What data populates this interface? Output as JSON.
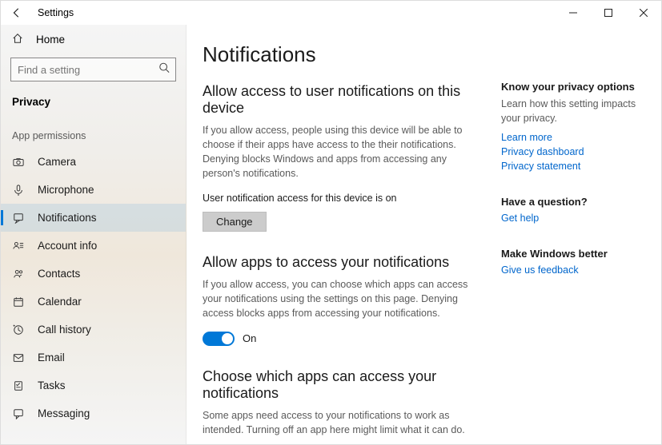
{
  "window": {
    "app_title": "Settings"
  },
  "sidebar": {
    "home_label": "Home",
    "search_placeholder": "Find a setting",
    "section_title": "Privacy",
    "group_label": "App permissions",
    "items": [
      {
        "label": "Camera"
      },
      {
        "label": "Microphone"
      },
      {
        "label": "Notifications"
      },
      {
        "label": "Account info"
      },
      {
        "label": "Contacts"
      },
      {
        "label": "Calendar"
      },
      {
        "label": "Call history"
      },
      {
        "label": "Email"
      },
      {
        "label": "Tasks"
      },
      {
        "label": "Messaging"
      }
    ]
  },
  "main": {
    "page_title": "Notifications",
    "section1": {
      "heading": "Allow access to user notifications on this device",
      "desc": "If you allow access, people using this device will be able to choose if their apps have access to the their notifications. Denying blocks Windows and apps from accessing any person's notifications.",
      "status": "User notification access for this device is on",
      "button": "Change"
    },
    "section2": {
      "heading": "Allow apps to access your notifications",
      "desc": "If you allow access, you can choose which apps can access your notifications using the settings on this page. Denying access blocks apps from accessing your notifications.",
      "toggle_state": "On"
    },
    "section3": {
      "heading": "Choose which apps can access your notifications",
      "desc": "Some apps need access to your notifications to work as intended. Turning off an app here might limit what it can do."
    }
  },
  "aside": {
    "privacy": {
      "heading": "Know your privacy options",
      "desc": "Learn how this setting impacts your privacy.",
      "links": [
        "Learn more",
        "Privacy dashboard",
        "Privacy statement"
      ]
    },
    "question": {
      "heading": "Have a question?",
      "link": "Get help"
    },
    "feedback": {
      "heading": "Make Windows better",
      "link": "Give us feedback"
    }
  }
}
